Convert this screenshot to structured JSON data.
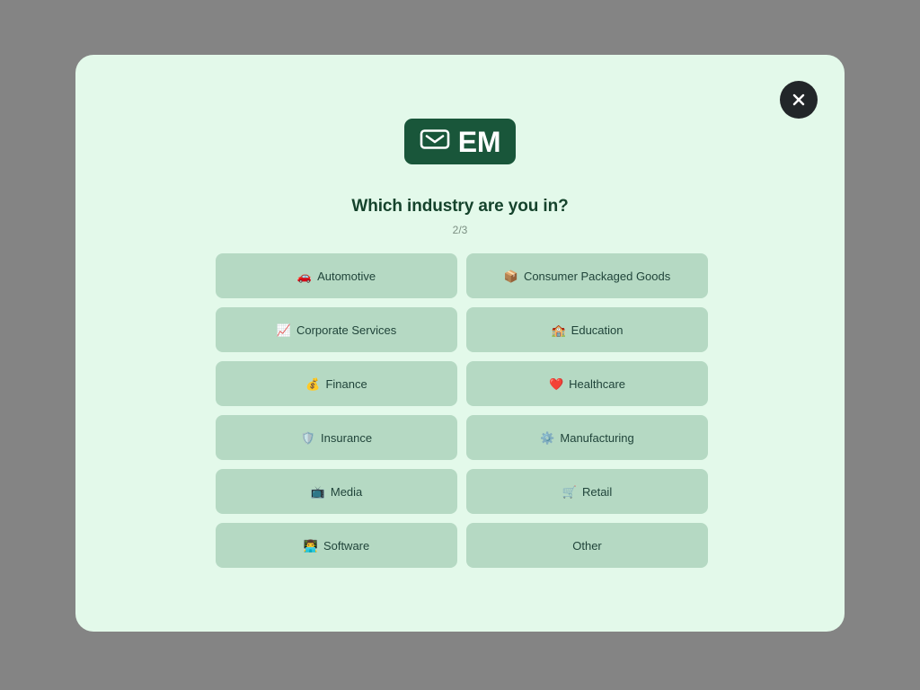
{
  "page": {
    "background_color": "#848484"
  },
  "modal": {
    "background_color": "#e3f9ea",
    "close_label": "×",
    "logo": {
      "icon": "envelope-icon",
      "text": "EM",
      "background_color": "#19563a"
    },
    "headline": "Which industry are you in?",
    "step_counter": "2/3",
    "options": [
      {
        "emoji": "🚗",
        "icon_name": "car-icon",
        "label": "Automotive"
      },
      {
        "emoji": "📦",
        "icon_name": "package-icon",
        "label": "Consumer Packaged Goods"
      },
      {
        "emoji": "📈",
        "icon_name": "chart-increasing-icon",
        "label": "Corporate Services"
      },
      {
        "emoji": "🏫",
        "icon_name": "school-icon",
        "label": "Education"
      },
      {
        "emoji": "💰",
        "icon_name": "money-bag-icon",
        "label": "Finance"
      },
      {
        "emoji": "❤️",
        "icon_name": "heart-icon",
        "label": "Healthcare"
      },
      {
        "emoji": "🛡️",
        "icon_name": "shield-icon",
        "label": "Insurance"
      },
      {
        "emoji": "⚙️",
        "icon_name": "gear-icon",
        "label": "Manufacturing"
      },
      {
        "emoji": "📺",
        "icon_name": "television-icon",
        "label": "Media"
      },
      {
        "emoji": "🛒",
        "icon_name": "shopping-cart-icon",
        "label": "Retail"
      },
      {
        "emoji": "👨‍💻",
        "icon_name": "technologist-icon",
        "label": "Software"
      },
      {
        "emoji": "",
        "icon_name": "",
        "label": "Other"
      }
    ]
  }
}
